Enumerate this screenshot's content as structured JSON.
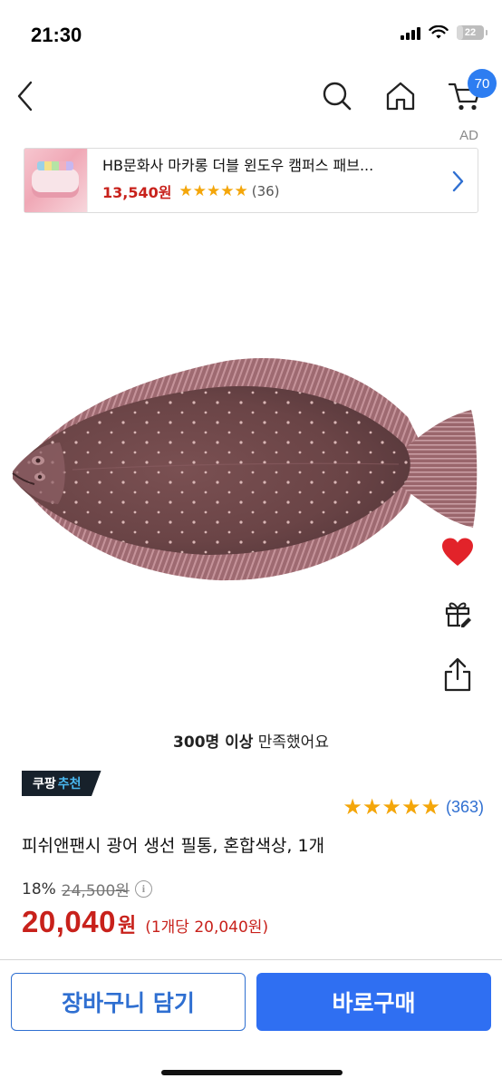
{
  "status_bar": {
    "time": "21:30",
    "battery": "22",
    "battery_level": 0.22
  },
  "nav": {
    "cart_count": "70",
    "icons": [
      "back-chevron-icon",
      "search-icon",
      "home-icon",
      "cart-icon"
    ]
  },
  "ad": {
    "label": "AD",
    "title": "HB문화사 마카롱 더블 윈도우 캠퍼스 패브...",
    "price": "13,540원",
    "stars": 5,
    "review_count": "(36)"
  },
  "product": {
    "satisfaction_strong": "300명 이상",
    "satisfaction_rest": " 만족했어요",
    "badge_main": "쿠팡",
    "badge_accent": "추천",
    "rating_stars": 5,
    "review_count": "(363)",
    "title": "피쉬앤팬시 광어 생선 필통, 혼합색상, 1개",
    "discount": "18%",
    "original_price": "24,500원",
    "sale_price": "20,040",
    "currency": "원",
    "unit_price": "(1개당 20,040원)"
  },
  "actions": {
    "cart_button": "장바구니 담기",
    "buy_button": "바로구매"
  },
  "colors": {
    "accent_blue": "#2f6ff2",
    "price_red": "#c8211b",
    "star": "#f4a60a",
    "heart": "#e2232a"
  }
}
